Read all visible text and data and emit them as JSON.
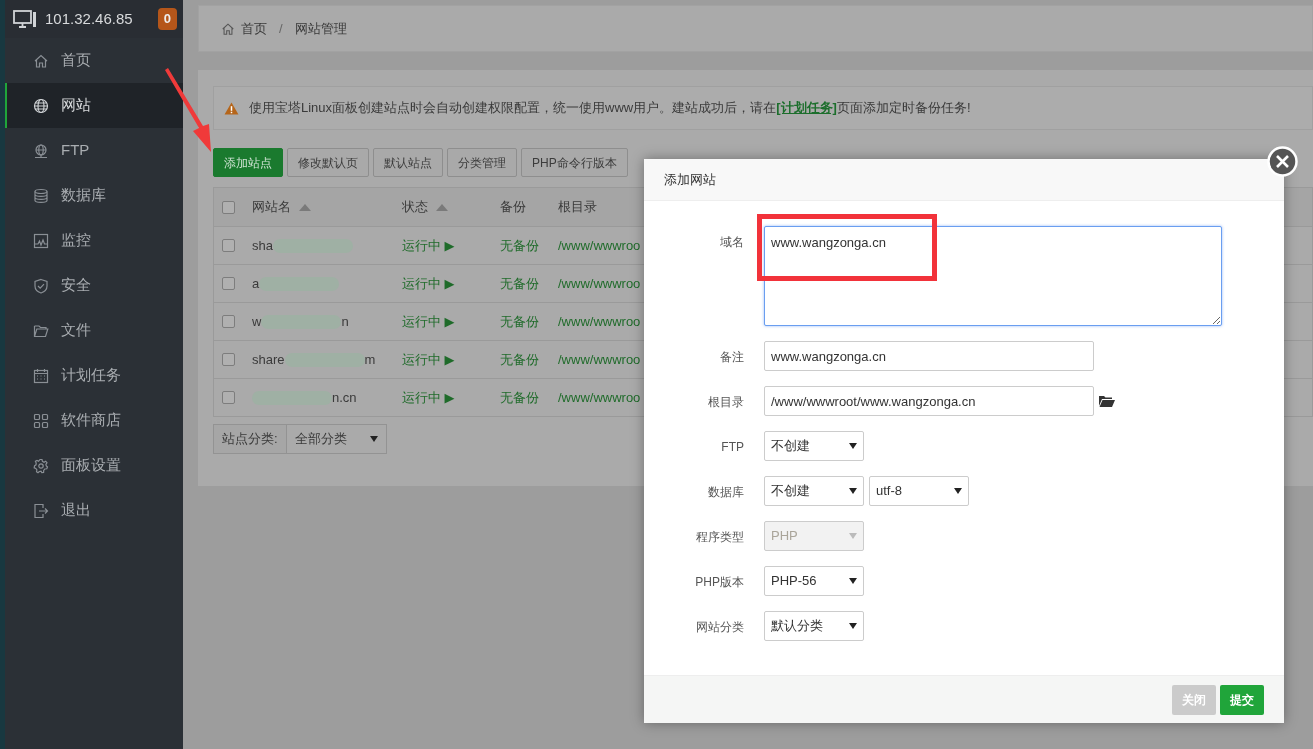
{
  "sidebar": {
    "host": "101.32.46.85",
    "badge": "0",
    "items": [
      {
        "label": "首页",
        "selected": false
      },
      {
        "label": "网站",
        "selected": true
      },
      {
        "label": "FTP",
        "selected": false
      },
      {
        "label": "数据库",
        "selected": false
      },
      {
        "label": "监控",
        "selected": false
      },
      {
        "label": "安全",
        "selected": false
      },
      {
        "label": "文件",
        "selected": false
      },
      {
        "label": "计划任务",
        "selected": false
      },
      {
        "label": "软件商店",
        "selected": false
      },
      {
        "label": "面板设置",
        "selected": false
      },
      {
        "label": "退出",
        "selected": false
      }
    ]
  },
  "breadcrumb": [
    "首页",
    "网站管理"
  ],
  "breadcrumb_separator": "/",
  "alert": {
    "text_before": "使用宝塔Linux面板创建站点时会自动创建权限配置，统一使用www用户。建站成功后，请在",
    "link": "[计划任务]",
    "text_after": "页面添加定时备份任务!"
  },
  "toolbar": [
    {
      "label": "添加站点",
      "primary": true
    },
    {
      "label": "修改默认页",
      "primary": false
    },
    {
      "label": "默认站点",
      "primary": false
    },
    {
      "label": "分类管理",
      "primary": false
    },
    {
      "label": "PHP命令行版本",
      "primary": false
    }
  ],
  "table": {
    "all_checked": false,
    "columns": [
      {
        "label": "网站名",
        "sortable": true
      },
      {
        "label": "状态",
        "sortable": true
      },
      {
        "label": "备份",
        "sortable": false
      },
      {
        "label": "根目录",
        "sortable": false
      }
    ],
    "rows": [
      {
        "checked": false,
        "name_start": "sha",
        "name_end": "",
        "status": "运行中 ▶",
        "backup": "无备份",
        "root": "/www/wwwroo"
      },
      {
        "checked": false,
        "name_start": "a",
        "name_end": "",
        "status": "运行中 ▶",
        "backup": "无备份",
        "root": "/www/wwwroo"
      },
      {
        "checked": false,
        "name_start": "w",
        "name_end": "n",
        "status": "运行中 ▶",
        "backup": "无备份",
        "root": "/www/wwwroo"
      },
      {
        "checked": false,
        "name_start": "share",
        "name_end": "m",
        "status": "运行中 ▶",
        "backup": "无备份",
        "root": "/www/wwwroo"
      },
      {
        "checked": false,
        "name_start": "",
        "name_end": "n.cn",
        "status": "运行中 ▶",
        "backup": "无备份",
        "root": "/www/wwwroo"
      }
    ]
  },
  "category_filter": {
    "label": "站点分类:",
    "value": "全部分类"
  },
  "modal": {
    "title": "添加网站",
    "fields": [
      {
        "kind": "textarea",
        "label": "域名",
        "value": "www.wangzonga.cn"
      },
      {
        "kind": "input",
        "label": "备注",
        "value": "www.wangzonga.cn"
      },
      {
        "kind": "path",
        "label": "根目录",
        "value": "/www/wwwroot/www.wangzonga.cn"
      },
      {
        "kind": "select",
        "label": "FTP",
        "selects": [
          {
            "value": "不创建",
            "disabled": false
          }
        ]
      },
      {
        "kind": "select",
        "label": "数据库",
        "selects": [
          {
            "value": "不创建",
            "disabled": false
          },
          {
            "value": "utf-8",
            "disabled": false
          }
        ]
      },
      {
        "kind": "select",
        "label": "程序类型",
        "selects": [
          {
            "value": "PHP",
            "disabled": true
          }
        ]
      },
      {
        "kind": "select",
        "label": "PHP版本",
        "selects": [
          {
            "value": "PHP-56",
            "disabled": false
          }
        ]
      },
      {
        "kind": "select",
        "label": "网站分类",
        "selects": [
          {
            "value": "默认分类",
            "disabled": false
          }
        ]
      }
    ],
    "buttons": [
      {
        "label": "关闭",
        "primary": false
      },
      {
        "label": "提交",
        "primary": true
      }
    ]
  },
  "annotations": {
    "arrow": true,
    "highlight_box": true
  }
}
